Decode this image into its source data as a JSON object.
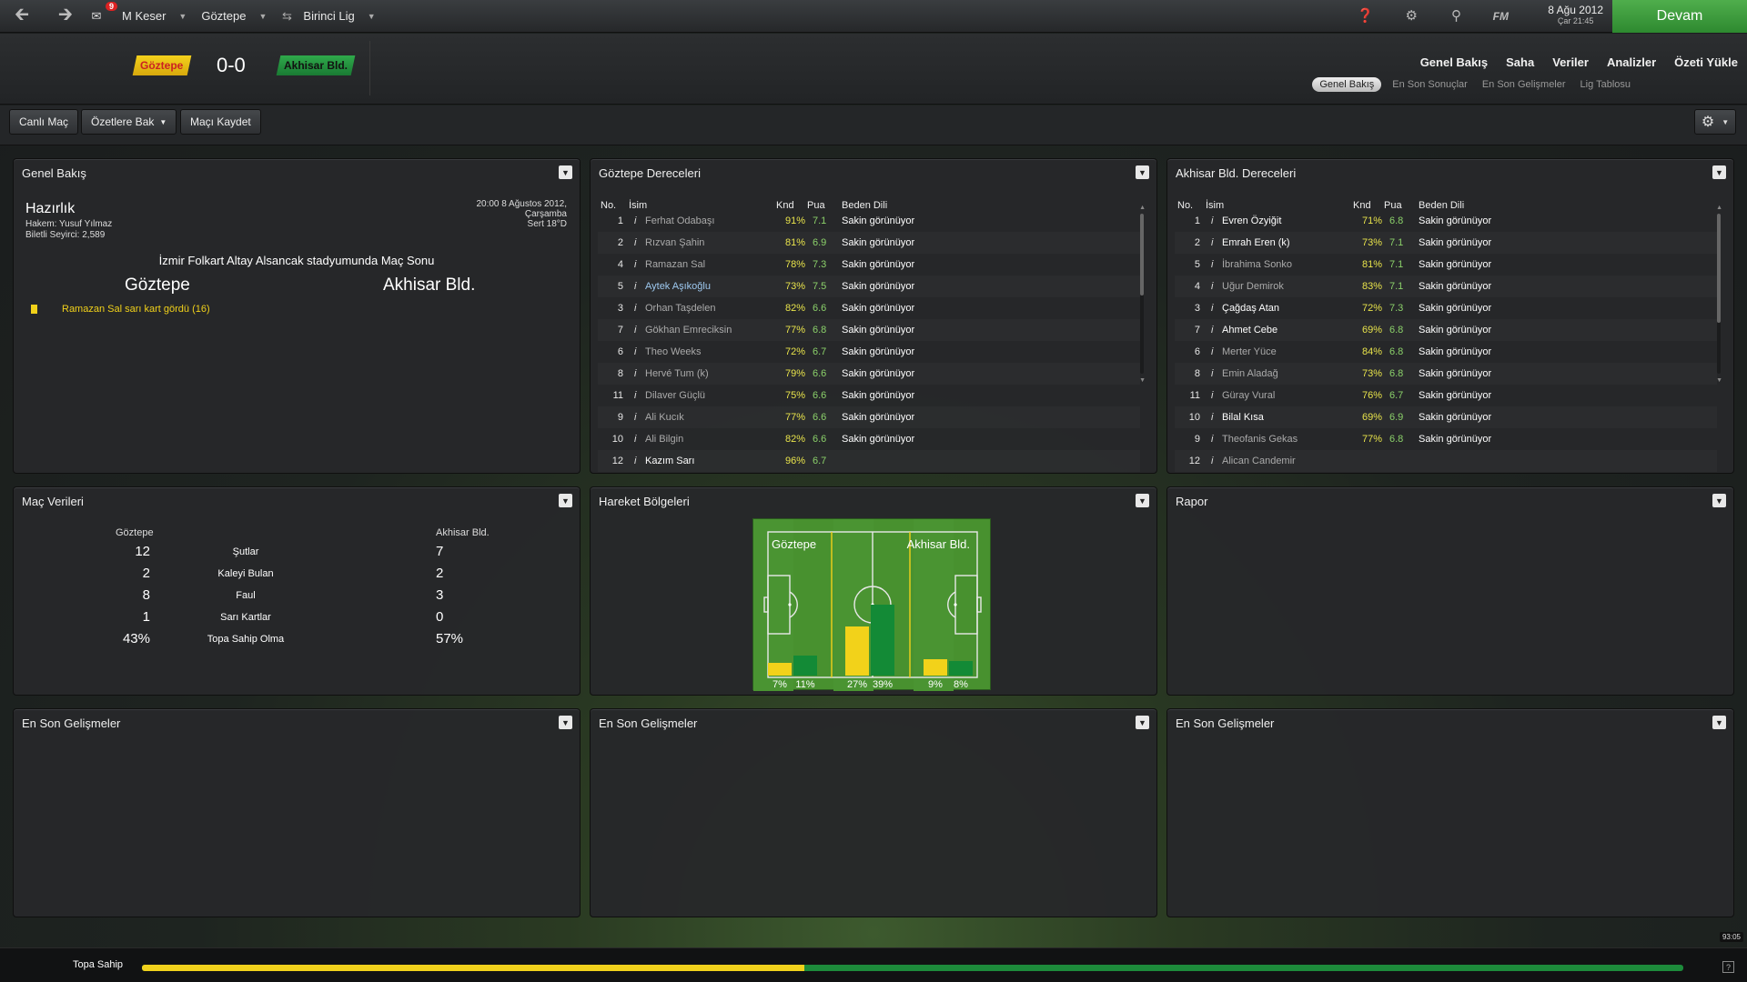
{
  "topbar": {
    "notification_count": "9",
    "manager": "M Keser",
    "club": "Göztepe",
    "league": "Birinci Lig",
    "date": "8 Ağu 2012",
    "time": "Çar 21:45",
    "continue_label": "Devam",
    "fm_label": "FM"
  },
  "header": {
    "home_team": "Göztepe",
    "away_team": "Akhisar Bld.",
    "score": "0-0",
    "nav": [
      "Genel Bakış",
      "Saha",
      "Veriler",
      "Analizler",
      "Özeti Yükle"
    ],
    "subnav": [
      "Genel Bakış",
      "En Son Sonuçlar",
      "En Son Gelişmeler",
      "Lig Tablosu"
    ]
  },
  "toolbar": {
    "live_label": "Canlı Maç",
    "highlights_label": "Özetlere Bak",
    "save_label": "Maçı Kaydet"
  },
  "overview": {
    "title": "Genel Bakış",
    "status": "Hazırlık",
    "referee": "Hakem: Yusuf Yılmaz",
    "attendance": "Biletli Seyirci: 2,589",
    "datetime_line1": "20:00 8 Ağustos 2012,",
    "datetime_line2": "Çarşamba",
    "weather": "Sert 18°D",
    "venue": "İzmir Folkart Altay Alsancak stadyumunda Maç Sonu",
    "home": "Göztepe",
    "away": "Akhisar Bld.",
    "event": "Ramazan Sal sarı kart gördü (16)"
  },
  "ratings_headers": {
    "no": "No.",
    "name": "İsim",
    "knd": "Knd",
    "pua": "Pua",
    "bd": "Beden Dili"
  },
  "home_ratings": {
    "title": "Göztepe Dereceleri",
    "rows": [
      {
        "no": "1",
        "name": "Ferhat Odabaşı",
        "knd": "91%",
        "pua": "7.1",
        "bd": "Sakin görünüyor",
        "style": ""
      },
      {
        "no": "2",
        "name": "Rızvan Şahin",
        "knd": "81%",
        "pua": "6.9",
        "bd": "Sakin görünüyor",
        "style": ""
      },
      {
        "no": "4",
        "name": "Ramazan Sal",
        "knd": "78%",
        "pua": "7.3",
        "bd": "Sakin görünüyor",
        "style": ""
      },
      {
        "no": "5",
        "name": "Aytek Aşıkoğlu",
        "knd": "73%",
        "pua": "7.5",
        "bd": "Sakin görünüyor",
        "style": "link"
      },
      {
        "no": "3",
        "name": "Orhan Taşdelen",
        "knd": "82%",
        "pua": "6.6",
        "bd": "Sakin görünüyor",
        "style": ""
      },
      {
        "no": "7",
        "name": "Gökhan Emreciksin",
        "knd": "77%",
        "pua": "6.8",
        "bd": "Sakin görünüyor",
        "style": ""
      },
      {
        "no": "6",
        "name": "Theo Weeks",
        "knd": "72%",
        "pua": "6.7",
        "bd": "Sakin görünüyor",
        "style": ""
      },
      {
        "no": "8",
        "name": "Hervé Tum (k)",
        "knd": "79%",
        "pua": "6.6",
        "bd": "Sakin görünüyor",
        "style": ""
      },
      {
        "no": "11",
        "name": "Dilaver Güçlü",
        "knd": "75%",
        "pua": "6.6",
        "bd": "Sakin görünüyor",
        "style": ""
      },
      {
        "no": "9",
        "name": "Ali Kucık",
        "knd": "77%",
        "pua": "6.6",
        "bd": "Sakin görünüyor",
        "style": ""
      },
      {
        "no": "10",
        "name": "Ali Bilgin",
        "knd": "82%",
        "pua": "6.6",
        "bd": "Sakin görünüyor",
        "style": ""
      },
      {
        "no": "12",
        "name": "Kazım Sarı",
        "knd": "96%",
        "pua": "6.7",
        "bd": "",
        "style": "hi"
      }
    ]
  },
  "away_ratings": {
    "title": "Akhisar Bld. Dereceleri",
    "rows": [
      {
        "no": "1",
        "name": "Evren Özyiğit",
        "knd": "71%",
        "pua": "6.8",
        "bd": "Sakin görünüyor",
        "style": "hi"
      },
      {
        "no": "2",
        "name": "Emrah Eren (k)",
        "knd": "73%",
        "pua": "7.1",
        "bd": "Sakin görünüyor",
        "style": "hi"
      },
      {
        "no": "5",
        "name": "İbrahima Sonko",
        "knd": "81%",
        "pua": "7.1",
        "bd": "Sakin görünüyor",
        "style": ""
      },
      {
        "no": "4",
        "name": "Uğur Demirok",
        "knd": "83%",
        "pua": "7.1",
        "bd": "Sakin görünüyor",
        "style": ""
      },
      {
        "no": "3",
        "name": "Çağdaş Atan",
        "knd": "72%",
        "pua": "7.3",
        "bd": "Sakin görünüyor",
        "style": "hi"
      },
      {
        "no": "7",
        "name": "Ahmet Cebe",
        "knd": "69%",
        "pua": "6.8",
        "bd": "Sakin görünüyor",
        "style": "hi"
      },
      {
        "no": "6",
        "name": "Merter Yüce",
        "knd": "84%",
        "pua": "6.8",
        "bd": "Sakin görünüyor",
        "style": ""
      },
      {
        "no": "8",
        "name": "Emin Aladağ",
        "knd": "73%",
        "pua": "6.8",
        "bd": "Sakin görünüyor",
        "style": ""
      },
      {
        "no": "11",
        "name": "Güray Vural",
        "knd": "76%",
        "pua": "6.7",
        "bd": "Sakin görünüyor",
        "style": ""
      },
      {
        "no": "10",
        "name": "Bilal Kısa",
        "knd": "69%",
        "pua": "6.9",
        "bd": "Sakin görünüyor",
        "style": "hi"
      },
      {
        "no": "9",
        "name": "Theofanis Gekas",
        "knd": "77%",
        "pua": "6.8",
        "bd": "Sakin görünüyor",
        "style": ""
      },
      {
        "no": "12",
        "name": "Alican Candemir",
        "knd": "",
        "pua": "",
        "bd": "",
        "style": ""
      }
    ]
  },
  "match_stats": {
    "title": "Maç Verileri",
    "home": "Göztepe",
    "away": "Akhisar Bld.",
    "rows": [
      {
        "label": "Şutlar",
        "home": "12",
        "away": "7"
      },
      {
        "label": "Kaleyi Bulan",
        "home": "2",
        "away": "2"
      },
      {
        "label": "Faul",
        "home": "8",
        "away": "3"
      },
      {
        "label": "Sarı Kartlar",
        "home": "1",
        "away": "0"
      },
      {
        "label": "Topa Sahip Olma",
        "home": "43%",
        "away": "57%"
      }
    ]
  },
  "action_zones": {
    "title": "Hareket Bölgeleri",
    "home": "Göztepe",
    "away": "Akhisar Bld.",
    "home_color": "#f2d21a",
    "away_color": "#138a36",
    "zones": [
      {
        "home": 7,
        "away": 11,
        "home_label": "7%",
        "away_label": "11%"
      },
      {
        "home": 27,
        "away": 39,
        "home_label": "27%",
        "away_label": "39%"
      },
      {
        "home": 9,
        "away": 8,
        "home_label": "9%",
        "away_label": "8%"
      }
    ]
  },
  "report": {
    "title": "Rapor"
  },
  "latest": {
    "title1": "En Son Gelişmeler",
    "title2": "En Son Gelişmeler",
    "title3": "En Son Gelişmeler"
  },
  "bottom": {
    "possession_label": "Topa Sahip",
    "home_possession": 0.43,
    "clock": "93:05"
  }
}
